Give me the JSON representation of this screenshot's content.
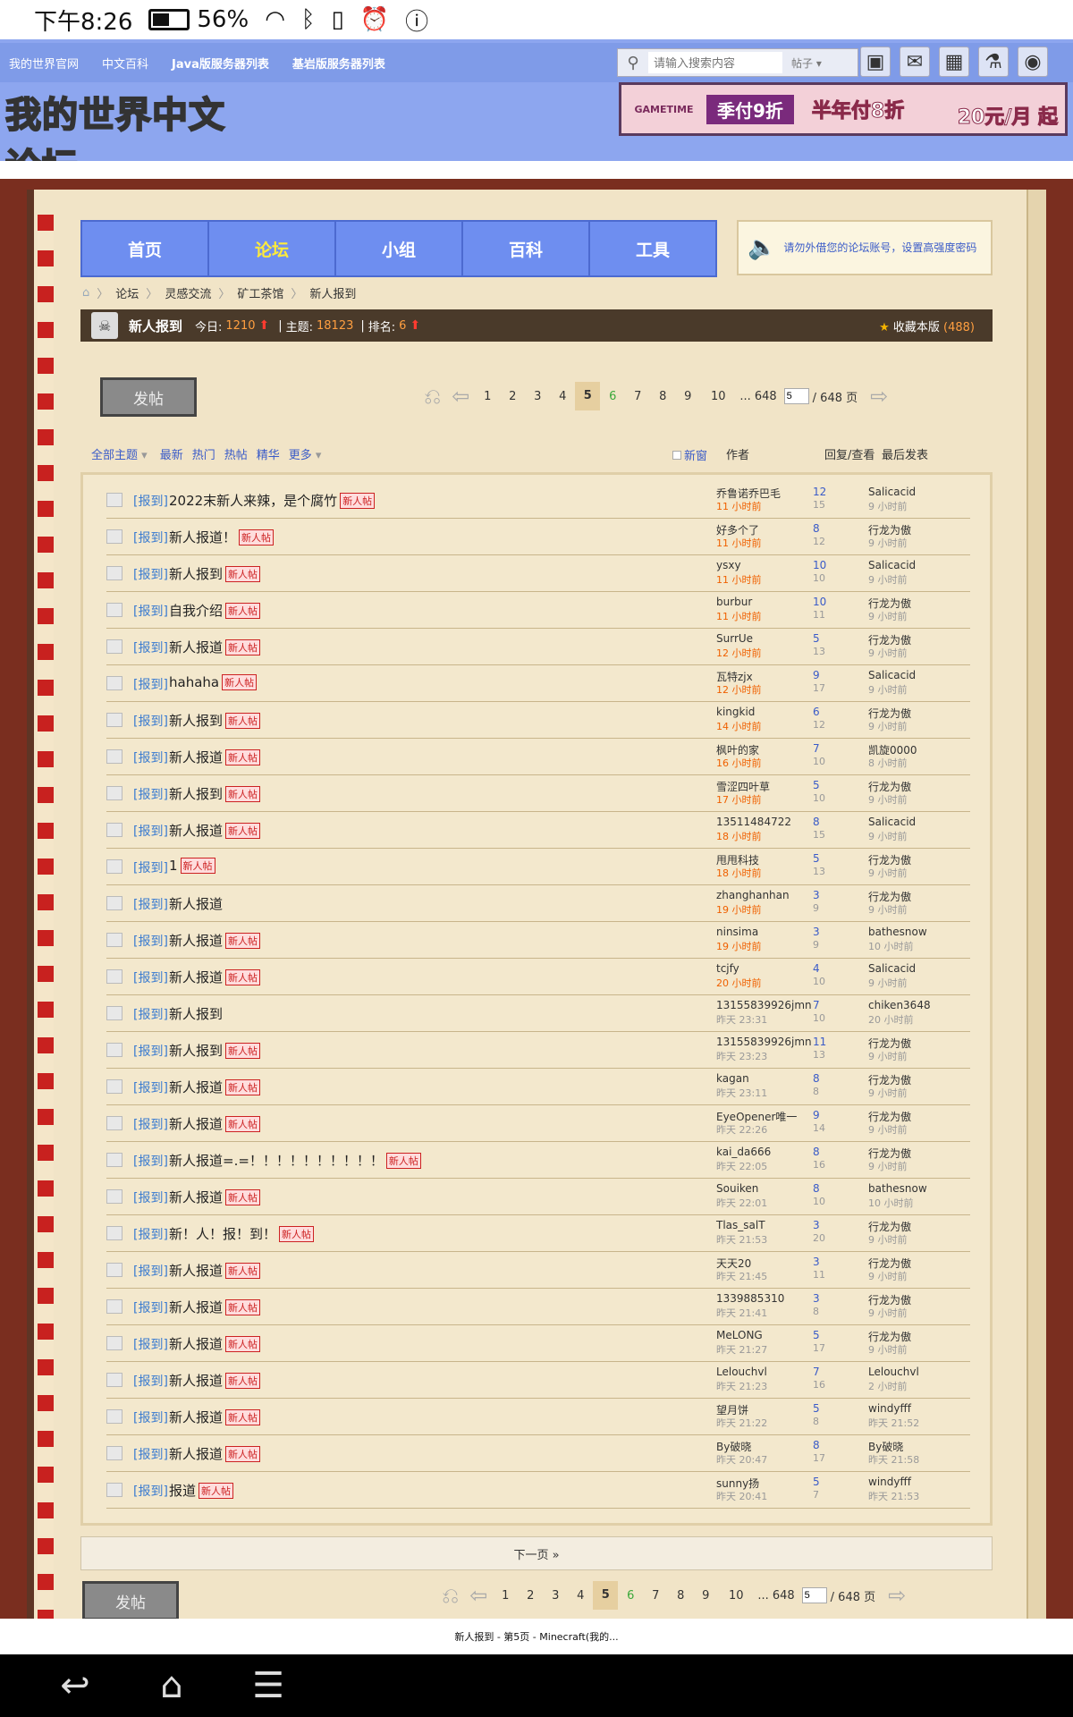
{
  "status": {
    "time": "下午8:26",
    "battery": "56%"
  },
  "topnav": {
    "links": [
      "我的世界官网",
      "中文百科",
      "Java版服务器列表",
      "基岩版服务器列表"
    ]
  },
  "search": {
    "placeholder": "请输入搜索内容",
    "scope": "帖子"
  },
  "logo_text": "我的世界中文论坛",
  "banner": {
    "brand": "GAMETIME",
    "l1": "季付9折",
    "l2": "半年付8折",
    "l3": "20元/月 起"
  },
  "mainnav": [
    "首页",
    "论坛",
    "小组",
    "百科",
    "工具"
  ],
  "notice": "请勿外借您的论坛账号，设置高强度密码",
  "breadcrumb": [
    "论坛",
    "灵感交流",
    "矿工茶馆",
    "新人报到"
  ],
  "forum": {
    "name": "新人报到",
    "today_label": "今日:",
    "today": "1210",
    "threads_label": "主题:",
    "threads": "18123",
    "rank_label": "排名:",
    "rank": "6",
    "fav_label": "收藏本版",
    "fav_count": "(488)"
  },
  "post_label": "发帖",
  "pager": {
    "pages": [
      "1",
      "2",
      "3",
      "4",
      "5",
      "6",
      "7",
      "8",
      "9",
      "10",
      "... 648"
    ],
    "current": "5",
    "input": "5",
    "total": "/ 648 页"
  },
  "filters": {
    "all": "全部主题",
    "items": [
      "最新",
      "热门",
      "热帖",
      "精华",
      "更多"
    ]
  },
  "columns": {
    "newwin": "新窗",
    "author": "作者",
    "reply": "回复/查看",
    "last": "最后发表"
  },
  "threads": [
    {
      "tag": "[报到]",
      "title": "2022末新人来辣，是个腐竹",
      "new": true,
      "author": "乔鲁诺乔巴毛",
      "atime": "11 小时前",
      "recent": true,
      "replies": "12",
      "views": "15",
      "last": "Salicacid",
      "ltime": "9 小时前"
    },
    {
      "tag": "[报到]",
      "title": "新人报道！",
      "new": true,
      "author": "好多个了",
      "atime": "11 小时前",
      "recent": true,
      "replies": "8",
      "views": "12",
      "last": "行龙为傲",
      "ltime": "9 小时前"
    },
    {
      "tag": "[报到]",
      "title": "新人报到",
      "new": true,
      "author": "ysxy",
      "atime": "11 小时前",
      "recent": true,
      "replies": "10",
      "views": "10",
      "last": "Salicacid",
      "ltime": "9 小时前"
    },
    {
      "tag": "[报到]",
      "title": "自我介绍",
      "new": true,
      "author": "burbur",
      "atime": "11 小时前",
      "recent": true,
      "replies": "10",
      "views": "11",
      "last": "行龙为傲",
      "ltime": "9 小时前"
    },
    {
      "tag": "[报到]",
      "title": "新人报道",
      "new": true,
      "author": "SurrUe",
      "atime": "12 小时前",
      "recent": true,
      "replies": "5",
      "views": "13",
      "last": "行龙为傲",
      "ltime": "9 小时前"
    },
    {
      "tag": "[报到]",
      "title": "hahaha",
      "new": true,
      "author": "瓦特zjx",
      "atime": "12 小时前",
      "recent": true,
      "replies": "9",
      "views": "17",
      "last": "Salicacid",
      "ltime": "9 小时前"
    },
    {
      "tag": "[报到]",
      "title": "新人报到",
      "new": true,
      "author": "kingkid",
      "atime": "14 小时前",
      "recent": true,
      "replies": "6",
      "views": "12",
      "last": "行龙为傲",
      "ltime": "9 小时前"
    },
    {
      "tag": "[报到]",
      "title": "新人报道",
      "new": true,
      "author": "枫叶的家",
      "atime": "16 小时前",
      "recent": true,
      "replies": "7",
      "views": "10",
      "last": "凯旋0000",
      "ltime": "8 小时前"
    },
    {
      "tag": "[报到]",
      "title": "新人报到",
      "new": true,
      "author": "雪涩四叶草",
      "atime": "17 小时前",
      "recent": true,
      "replies": "5",
      "views": "10",
      "last": "行龙为傲",
      "ltime": "9 小时前"
    },
    {
      "tag": "[报到]",
      "title": "新人报道",
      "new": true,
      "author": "13511484722",
      "atime": "18 小时前",
      "recent": true,
      "replies": "8",
      "views": "15",
      "last": "Salicacid",
      "ltime": "9 小时前"
    },
    {
      "tag": "[报到]",
      "title": "1",
      "new": true,
      "author": "甩甩科技",
      "atime": "18 小时前",
      "recent": true,
      "replies": "5",
      "views": "13",
      "last": "行龙为傲",
      "ltime": "9 小时前"
    },
    {
      "tag": "[报到]",
      "title": "新人报道",
      "new": false,
      "author": "zhanghanhan",
      "atime": "19 小时前",
      "recent": true,
      "replies": "3",
      "views": "9",
      "last": "行龙为傲",
      "ltime": "9 小时前"
    },
    {
      "tag": "[报到]",
      "title": "新人报道",
      "new": true,
      "author": "ninsima",
      "atime": "19 小时前",
      "recent": true,
      "replies": "3",
      "views": "9",
      "last": "bathesnow",
      "ltime": "10 小时前"
    },
    {
      "tag": "[报到]",
      "title": "新人报道",
      "new": true,
      "author": "tcjfy",
      "atime": "20 小时前",
      "recent": true,
      "replies": "4",
      "views": "10",
      "last": "Salicacid",
      "ltime": "9 小时前"
    },
    {
      "tag": "[报到]",
      "title": "新人报到",
      "new": false,
      "author": "13155839926jmn",
      "atime": "昨天 23:31",
      "recent": false,
      "replies": "7",
      "views": "10",
      "last": "chiken3648",
      "ltime": "20 小时前"
    },
    {
      "tag": "[报到]",
      "title": "新人报到",
      "new": true,
      "author": "13155839926jmn",
      "atime": "昨天 23:23",
      "recent": false,
      "replies": "11",
      "views": "13",
      "last": "行龙为傲",
      "ltime": "9 小时前"
    },
    {
      "tag": "[报到]",
      "title": "新人报道",
      "new": true,
      "author": "kagan",
      "atime": "昨天 23:11",
      "recent": false,
      "replies": "8",
      "views": "8",
      "last": "行龙为傲",
      "ltime": "9 小时前"
    },
    {
      "tag": "[报到]",
      "title": "新人报道",
      "new": true,
      "author": "EyeOpener唯一",
      "atime": "昨天 22:26",
      "recent": false,
      "replies": "9",
      "views": "14",
      "last": "行龙为傲",
      "ltime": "9 小时前"
    },
    {
      "tag": "[报到]",
      "title": "新人报道=.=！！！！！！！！！！",
      "new": true,
      "author": "kai_da666",
      "atime": "昨天 22:05",
      "recent": false,
      "replies": "8",
      "views": "16",
      "last": "行龙为傲",
      "ltime": "9 小时前"
    },
    {
      "tag": "[报到]",
      "title": "新人报道",
      "new": true,
      "author": "Souiken",
      "atime": "昨天 22:01",
      "recent": false,
      "replies": "8",
      "views": "10",
      "last": "bathesnow",
      "ltime": "10 小时前"
    },
    {
      "tag": "[报到]",
      "title": "新！人！报！到！",
      "new": true,
      "author": "Tlas_salT",
      "atime": "昨天 21:53",
      "recent": false,
      "replies": "3",
      "views": "20",
      "last": "行龙为傲",
      "ltime": "9 小时前"
    },
    {
      "tag": "[报到]",
      "title": "新人报道",
      "new": true,
      "author": "天天20",
      "atime": "昨天 21:45",
      "recent": false,
      "replies": "3",
      "views": "11",
      "last": "行龙为傲",
      "ltime": "9 小时前"
    },
    {
      "tag": "[报到]",
      "title": "新人报道",
      "new": true,
      "author": "1339885310",
      "atime": "昨天 21:41",
      "recent": false,
      "replies": "3",
      "views": "8",
      "last": "行龙为傲",
      "ltime": "9 小时前"
    },
    {
      "tag": "[报到]",
      "title": "新人报道",
      "new": true,
      "author": "MeLONG",
      "atime": "昨天 21:27",
      "recent": false,
      "replies": "5",
      "views": "17",
      "last": "行龙为傲",
      "ltime": "9 小时前"
    },
    {
      "tag": "[报到]",
      "title": "新人报道",
      "new": true,
      "author": "Lelouchvl",
      "atime": "昨天 21:23",
      "recent": false,
      "replies": "7",
      "views": "16",
      "last": "Lelouchvl",
      "ltime": "2 小时前"
    },
    {
      "tag": "[报到]",
      "title": "新人报道",
      "new": true,
      "author": "望月饼",
      "atime": "昨天 21:22",
      "recent": false,
      "replies": "5",
      "views": "8",
      "last": "windyfff",
      "ltime": "昨天 21:52"
    },
    {
      "tag": "[报到]",
      "title": "新人报道",
      "new": true,
      "author": "By破晓",
      "atime": "昨天 20:47",
      "recent": false,
      "replies": "8",
      "views": "17",
      "last": "By破晓",
      "ltime": "昨天 21:58"
    },
    {
      "tag": "[报到]",
      "title": "报道",
      "new": true,
      "author": "sunny扬",
      "atime": "昨天 20:41",
      "recent": false,
      "replies": "5",
      "views": "7",
      "last": "windyfff",
      "ltime": "昨天 21:53"
    }
  ],
  "new_badge": "新人帖",
  "next_page": "下一页 »",
  "page_title": "新人报到 - 第5页 - Minecraft(我的..."
}
